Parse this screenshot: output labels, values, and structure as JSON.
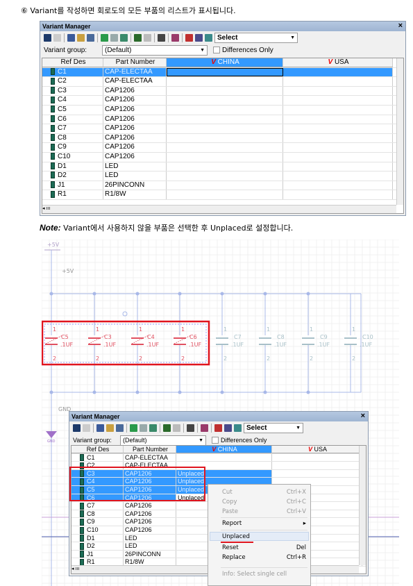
{
  "step_text": "⑥  Variant를 작성하면 회로도의 모든 부품의 리스트가 표시됩니다.",
  "note_label": "Note:",
  "note_text": " Variant에서 사용하지 않을 부품은 선택한 후 Unplaced로 설정합니다.",
  "window1": {
    "title": "Variant Manager",
    "close": "×",
    "select_label": "Select",
    "variant_group_label": "Variant group:",
    "variant_group_value": "(Default)",
    "differences_only": "Differences Only",
    "columns": [
      "Ref Des",
      "Part Number",
      "CHINA",
      "USA"
    ],
    "rows": [
      [
        "C1",
        "CAP-ELECTAA",
        "",
        ""
      ],
      [
        "C2",
        "CAP-ELECTAA",
        "",
        ""
      ],
      [
        "C3",
        "CAP1206",
        "",
        ""
      ],
      [
        "C4",
        "CAP1206",
        "",
        ""
      ],
      [
        "C5",
        "CAP1206",
        "",
        ""
      ],
      [
        "C6",
        "CAP1206",
        "",
        ""
      ],
      [
        "C7",
        "CAP1206",
        "",
        ""
      ],
      [
        "C8",
        "CAP1206",
        "",
        ""
      ],
      [
        "C9",
        "CAP1206",
        "",
        ""
      ],
      [
        "C10",
        "CAP1206",
        "",
        ""
      ],
      [
        "D1",
        "LED",
        "",
        ""
      ],
      [
        "D2",
        "LED",
        "",
        ""
      ],
      [
        "J1",
        "26PINCONN",
        "",
        ""
      ],
      [
        "R1",
        "R1/8W",
        "",
        ""
      ]
    ],
    "selected_rows": [
      0
    ]
  },
  "window2": {
    "title": "Variant Manager",
    "close": "×",
    "select_label": "Select",
    "variant_group_label": "Variant group:",
    "variant_group_value": "(Default)",
    "differences_only": "Differences Only",
    "columns": [
      "Ref Des",
      "Part Number",
      "CHINA",
      "USA"
    ],
    "rows": [
      [
        "C1",
        "CAP-ELECTAA",
        "",
        ""
      ],
      [
        "C2",
        "CAP-ELECTAA",
        "",
        ""
      ],
      [
        "C3",
        "CAP1206",
        "Unplaced",
        ""
      ],
      [
        "C4",
        "CAP1206",
        "Unplaced",
        ""
      ],
      [
        "C5",
        "CAP1206",
        "Unplaced",
        ""
      ],
      [
        "C6",
        "CAP1206",
        "Unplaced",
        ""
      ],
      [
        "C7",
        "CAP1206",
        "",
        ""
      ],
      [
        "C8",
        "CAP1206",
        "",
        ""
      ],
      [
        "C9",
        "CAP1206",
        "",
        ""
      ],
      [
        "C10",
        "CAP1206",
        "",
        ""
      ],
      [
        "D1",
        "LED",
        "",
        ""
      ],
      [
        "D2",
        "LED",
        "",
        ""
      ],
      [
        "J1",
        "26PINCONN",
        "",
        ""
      ],
      [
        "R1",
        "R1/8W",
        "",
        ""
      ]
    ],
    "selected_rows": [
      2,
      3,
      4,
      5
    ]
  },
  "context_menu": [
    {
      "label": "Cut",
      "shortcut": "Ctrl+X",
      "disabled": true
    },
    {
      "label": "Copy",
      "shortcut": "Ctrl+C",
      "disabled": true
    },
    {
      "label": "Paste",
      "shortcut": "Ctrl+V",
      "disabled": true
    },
    {
      "label": "Report",
      "shortcut": "▸",
      "disabled": false
    },
    {
      "label": "Unplaced",
      "shortcut": "",
      "disabled": false,
      "highlighted": true
    },
    {
      "label": "Reset",
      "shortcut": "Del",
      "disabled": false
    },
    {
      "label": "Replace",
      "shortcut": "Ctrl+R",
      "disabled": false
    },
    {
      "label": "Info: Select single cell",
      "shortcut": "",
      "disabled": true
    }
  ],
  "schematic": {
    "power_label": "+5V",
    "net_label": "+5V",
    "gnd_label": "GND",
    "gnd_symbol_label": "GND",
    "pin1": "1",
    "pin2": "2",
    "capacitors": [
      {
        "ref": "C5",
        "value": ".1UF",
        "unplaced": true
      },
      {
        "ref": "C3",
        "value": ".1UF",
        "unplaced": true
      },
      {
        "ref": "C4",
        "value": ".1UF",
        "unplaced": true
      },
      {
        "ref": "C6",
        "value": ".1UF",
        "unplaced": true
      },
      {
        "ref": "C7",
        "value": ".1UF",
        "unplaced": false
      },
      {
        "ref": "C8",
        "value": ".1UF",
        "unplaced": false
      },
      {
        "ref": "C9",
        "value": ".1UF",
        "unplaced": false
      },
      {
        "ref": "C10",
        "value": ".1UF",
        "unplaced": false
      }
    ]
  },
  "colors": {
    "highlight": "#3399ff",
    "annotation_red": "#e0141e",
    "wire": "#a8b8e8",
    "unplaced": "#e05060"
  }
}
